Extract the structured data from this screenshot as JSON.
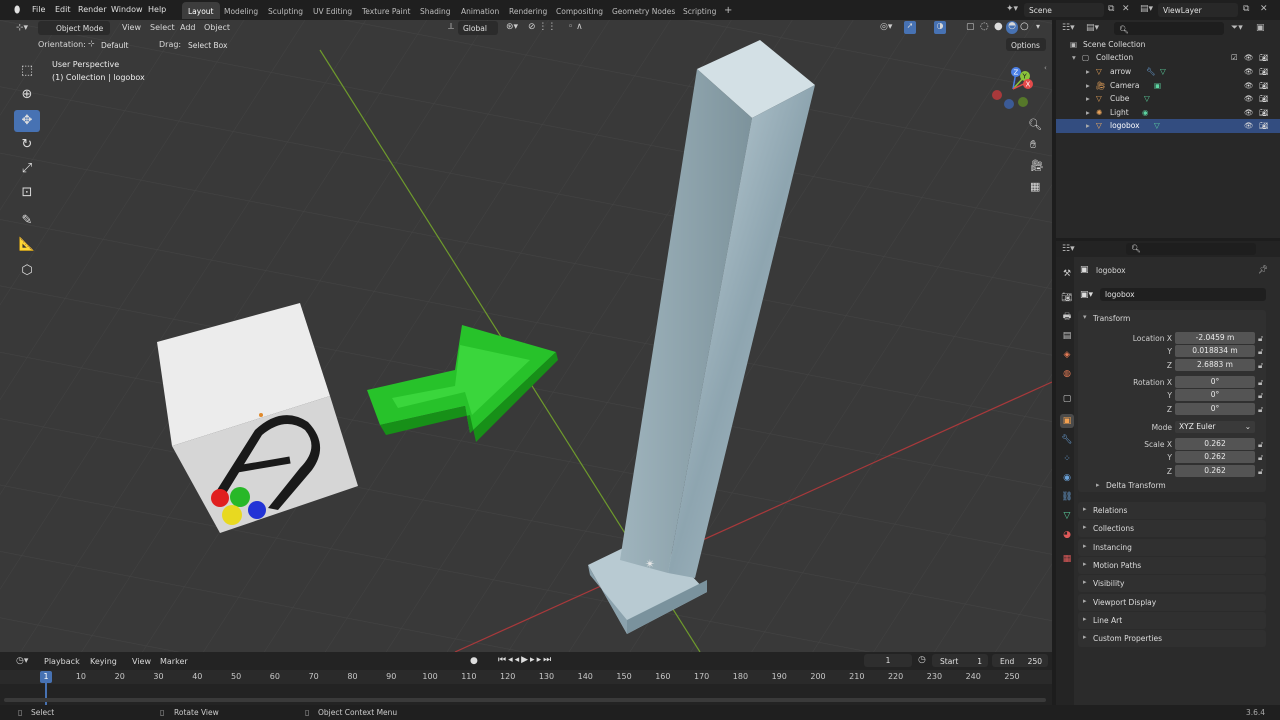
{
  "topbar": {
    "menus": [
      "File",
      "Edit",
      "Render",
      "Window",
      "Help"
    ],
    "workspaces": [
      "Layout",
      "Modeling",
      "Sculpting",
      "UV Editing",
      "Texture Paint",
      "Shading",
      "Animation",
      "Rendering",
      "Compositing",
      "Geometry Nodes",
      "Scripting"
    ],
    "active_workspace": "Layout",
    "add_tab": "+",
    "scene": "Scene",
    "view_layer": "ViewLayer"
  },
  "viewport": {
    "mode": "Object Mode",
    "menus": [
      "View",
      "Select",
      "Add",
      "Object"
    ],
    "orientation_label": "Orientation:",
    "orientation_value": "Default",
    "drag_label": "Drag:",
    "drag_value": "Select Box",
    "transform_orientation": "Global",
    "options": "Options",
    "overlay_title": "User Perspective",
    "overlay_subtitle": "(1) Collection | logobox",
    "gizmo": {
      "x": "X",
      "y": "Y",
      "z": "Z"
    }
  },
  "outliner": {
    "scene_collection": "Scene Collection",
    "collection": "Collection",
    "items": [
      "arrow",
      "Camera",
      "Cube",
      "Light",
      "logobox"
    ]
  },
  "properties": {
    "object_name": "logobox",
    "data_name": "logobox",
    "transform_header": "Transform",
    "location_label": "Location X",
    "location": [
      "-2.0459 m",
      "0.018834 m",
      "2.6883 m"
    ],
    "rotation_label": "Rotation X",
    "rotation": [
      "0°",
      "0°",
      "0°"
    ],
    "mode_label": "Mode",
    "mode_value": "XYZ Euler",
    "scale_label": "Scale X",
    "scale": [
      "0.262",
      "0.262",
      "0.262"
    ],
    "axis_y": "Y",
    "axis_z": "Z",
    "delta": "Delta Transform",
    "panels": [
      "Relations",
      "Collections",
      "Instancing",
      "Motion Paths",
      "Visibility",
      "Viewport Display",
      "Line Art",
      "Custom Properties"
    ]
  },
  "timeline": {
    "menus": [
      "Playback",
      "Keying",
      "View",
      "Marker"
    ],
    "current_frame": "1",
    "start_label": "Start",
    "start": "1",
    "end_label": "End",
    "end": "250",
    "ticks": [
      "1",
      "10",
      "20",
      "30",
      "40",
      "50",
      "60",
      "70",
      "80",
      "90",
      "100",
      "110",
      "120",
      "130",
      "140",
      "150",
      "160",
      "170",
      "180",
      "190",
      "200",
      "210",
      "220",
      "230",
      "240",
      "250"
    ]
  },
  "statusbar": {
    "select": "Select",
    "rotate": "Rotate View",
    "context": "Object Context Menu",
    "version": "3.6.4"
  },
  "colors": {
    "accent": "#4772b3",
    "arrow": "#27c22a",
    "x_axis": "#e44a4a",
    "y_axis": "#8bc43b",
    "z_axis": "#4c80e6"
  }
}
